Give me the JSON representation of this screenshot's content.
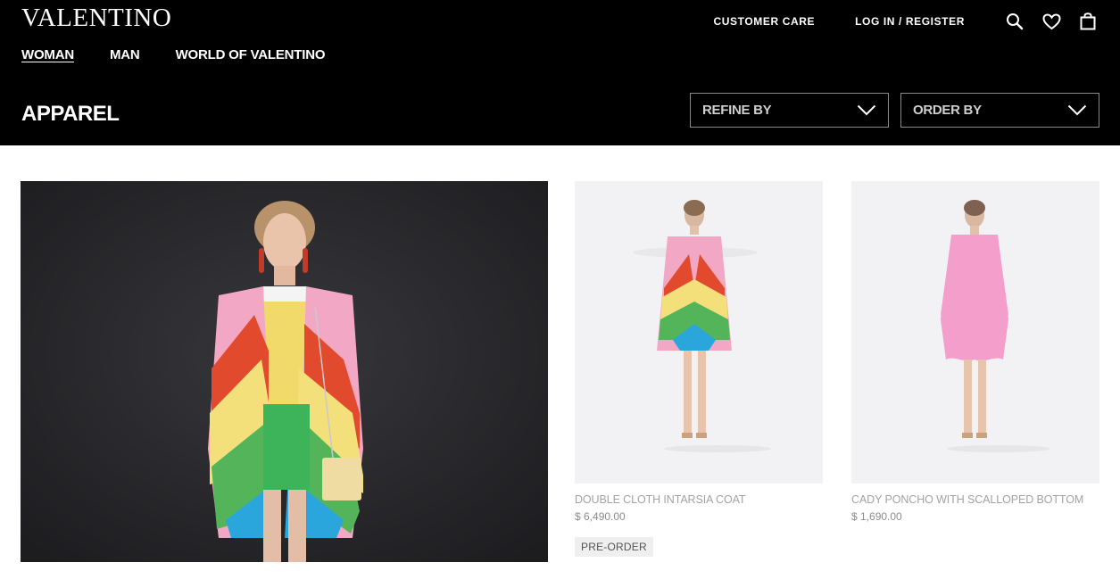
{
  "header": {
    "logo": "VALENTINO",
    "top_links": {
      "customer_care": "CUSTOMER CARE",
      "login": "LOG IN / REGISTER"
    },
    "icons": [
      "search-icon",
      "heart-icon",
      "bag-icon"
    ],
    "nav": [
      "WOMAN",
      "MAN",
      "WORLD OF VALENTINO"
    ],
    "active_nav": "WOMAN",
    "page_title": "APPAREL",
    "refine_label": "REFINE BY",
    "order_label": "ORDER BY"
  },
  "products": [
    {
      "name": "DOUBLE CLOTH INTARSIA COAT",
      "price": "$ 6,490.00",
      "badge": "PRE-ORDER"
    },
    {
      "name": "CADY PONCHO WITH SCALLOPED BOTTOM",
      "price": "$ 1,690.00"
    }
  ],
  "colors": {
    "header_bg": "#000000",
    "card_bg": "#f2f2f4",
    "accent_text": "#a3a3a3"
  }
}
